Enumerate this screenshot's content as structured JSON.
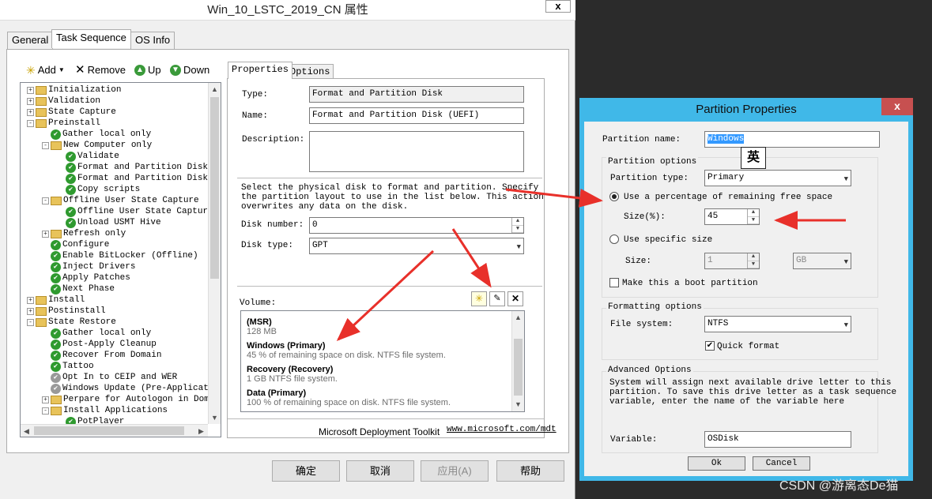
{
  "main_window": {
    "title": "Win_10_LSTC_2019_CN 属性",
    "close_label": "x",
    "tabs": [
      "General",
      "Task Sequence",
      "OS Info"
    ],
    "toolbar": {
      "add": "Add",
      "remove": "Remove",
      "up": "Up",
      "down": "Down"
    },
    "tree": [
      {
        "label": "Initialization",
        "level": 0,
        "kind": "folder",
        "expander": "+"
      },
      {
        "label": "Validation",
        "level": 0,
        "kind": "folder",
        "expander": "+"
      },
      {
        "label": "State Capture",
        "level": 0,
        "kind": "folder",
        "expander": "+"
      },
      {
        "label": "Preinstall",
        "level": 0,
        "kind": "folder",
        "expander": "-"
      },
      {
        "label": "Gather local only",
        "level": 1,
        "kind": "check"
      },
      {
        "label": "New Computer only",
        "level": 1,
        "kind": "folder",
        "expander": "-"
      },
      {
        "label": "Validate",
        "level": 2,
        "kind": "check"
      },
      {
        "label": "Format and Partition Disk (",
        "level": 2,
        "kind": "check"
      },
      {
        "label": "Format and Partition Disk (",
        "level": 2,
        "kind": "check"
      },
      {
        "label": "Copy scripts",
        "level": 2,
        "kind": "check"
      },
      {
        "label": "Offline User State Capture",
        "level": 1,
        "kind": "folder",
        "expander": "-"
      },
      {
        "label": "Offline User State Capture",
        "level": 2,
        "kind": "check"
      },
      {
        "label": "Unload USMT Hive",
        "level": 2,
        "kind": "check"
      },
      {
        "label": "Refresh only",
        "level": 1,
        "kind": "folder",
        "expander": "+"
      },
      {
        "label": "Configure",
        "level": 1,
        "kind": "check"
      },
      {
        "label": "Enable BitLocker (Offline)",
        "level": 1,
        "kind": "check"
      },
      {
        "label": "Inject Drivers",
        "level": 1,
        "kind": "check"
      },
      {
        "label": "Apply Patches",
        "level": 1,
        "kind": "check"
      },
      {
        "label": "Next Phase",
        "level": 1,
        "kind": "check"
      },
      {
        "label": "Install",
        "level": 0,
        "kind": "folder",
        "expander": "+"
      },
      {
        "label": "Postinstall",
        "level": 0,
        "kind": "folder",
        "expander": "+"
      },
      {
        "label": "State Restore",
        "level": 0,
        "kind": "folder",
        "expander": "-"
      },
      {
        "label": "Gather local only",
        "level": 1,
        "kind": "check"
      },
      {
        "label": "Post-Apply Cleanup",
        "level": 1,
        "kind": "check"
      },
      {
        "label": "Recover From Domain",
        "level": 1,
        "kind": "check"
      },
      {
        "label": "Tattoo",
        "level": 1,
        "kind": "check"
      },
      {
        "label": "Opt In to CEIP and WER",
        "level": 1,
        "kind": "gray"
      },
      {
        "label": "Windows Update (Pre-Applicatio",
        "level": 1,
        "kind": "gray"
      },
      {
        "label": "Perpare for Autologon in Domai",
        "level": 1,
        "kind": "folder",
        "expander": "+"
      },
      {
        "label": "Install Applications",
        "level": 1,
        "kind": "folder",
        "expander": "-"
      },
      {
        "label": "PotPlayer",
        "level": 2,
        "kind": "check"
      }
    ],
    "props_tabs": [
      "Properties",
      "Options"
    ],
    "type_label": "Type:",
    "type_value": "Format and Partition Disk",
    "name_label": "Name:",
    "name_value": "Format and Partition Disk (UEFI)",
    "description_label": "Description:",
    "description_value": "",
    "instructions": [
      "Select the physical disk to format and partition.  Specify",
      "the partition layout to use in the list below. This action",
      "overwrites any data on the disk."
    ],
    "disk_number_label": "Disk number:",
    "disk_number_value": "0",
    "disk_type_label": "Disk type:",
    "disk_type_value": "GPT",
    "volume_label": "Volume:",
    "volumes": [
      {
        "name": "(MSR)",
        "desc": "128 MB"
      },
      {
        "name": "Windows (Primary)",
        "desc": "45 % of remaining space on disk. NTFS file system."
      },
      {
        "name": "Recovery (Recovery)",
        "desc": "1 GB NTFS file system."
      },
      {
        "name": "Data (Primary)",
        "desc": "100 % of remaining space on disk. NTFS file system."
      }
    ],
    "footer_text": "Microsoft Deployment Toolkit",
    "footer_link": "www.microsoft.com/mdt",
    "buttons": {
      "ok": "确定",
      "cancel": "取消",
      "apply": "应用(A)",
      "help": "帮助"
    }
  },
  "partition_dialog": {
    "title": "Partition Properties",
    "close_label": "x",
    "partition_name_label": "Partition name:",
    "partition_name_value": "Windows",
    "partition_options_label": "Partition options",
    "partition_type_label": "Partition type:",
    "partition_type_value": "Primary",
    "use_percentage_label": "Use a percentage of remaining free space",
    "size_pct_label": "Size(%):",
    "size_pct_value": "45",
    "use_specific_label": "Use specific size",
    "size_label": "Size:",
    "size_value": "1",
    "size_unit": "GB",
    "boot_partition_label": "Make this a boot partition",
    "formatting_label": "Formatting options",
    "filesystem_label": "File system:",
    "filesystem_value": "NTFS",
    "quick_format_label": "Quick format",
    "advanced_label": "Advanced Options",
    "advanced_text": [
      "System will assign next available drive letter to this",
      "partition. To save this drive letter as a task sequence",
      "variable, enter the name of the variable here"
    ],
    "variable_label": "Variable:",
    "variable_value": "OSDisk",
    "ok_label": "Ok",
    "cancel_label": "Cancel"
  },
  "ime_indicator": "英",
  "watermark": "CSDN @游离态De猫",
  "colors": {
    "dialog_border": "#40b8e8",
    "close_red": "#c75050",
    "arrow_red": "#e8302a",
    "check_green": "#2f9a2f"
  }
}
